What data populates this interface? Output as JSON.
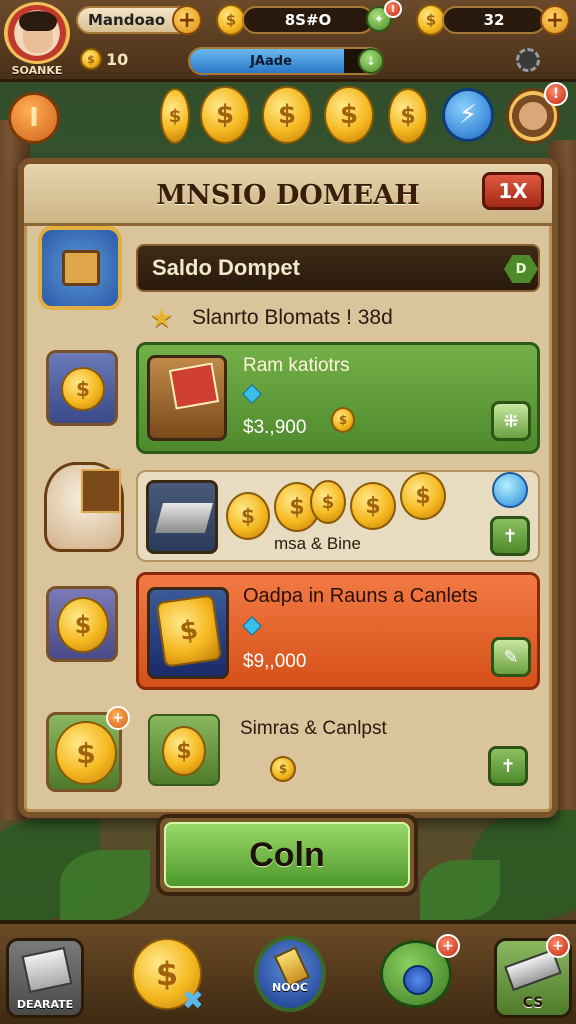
{
  "top_bar": {
    "player_name": "Mandoao",
    "avatar_label": "SOANKE",
    "currency_1": "8S#O",
    "currency_2": "32",
    "small_coin_count": "10",
    "progress_label": "JAade",
    "progress_fraction": 0.8
  },
  "panel": {
    "title": "MNSIO DOMEAH",
    "close_label": "1X",
    "wallet_label": "Saldo Dompet",
    "wallet_badge": "D",
    "subtitle": "Slanrto Blomats ! 38d",
    "rows": [
      {
        "title": "Ram katiotrs",
        "price": "$3.,900"
      },
      {
        "title": "msa & Bine"
      },
      {
        "title": "Oadpa in Rauns a Canlets",
        "price": "$9,,000"
      },
      {
        "title": "Simras & Canlpst"
      }
    ]
  },
  "primary_button": {
    "label": "Coln"
  },
  "bottom_nav": [
    {
      "label": "DEARATE"
    },
    {
      "label": ""
    },
    {
      "label": "NOOC"
    },
    {
      "label": ""
    },
    {
      "label": "CS"
    }
  ],
  "colors": {
    "accent_green": "#4e8a2c",
    "accent_orange": "#d65018",
    "panel_bg": "#d9c49b",
    "frame_brown": "#7a5228"
  },
  "icons": [
    "shield-icon",
    "star-icon",
    "coin-icon",
    "gem-icon",
    "chest-icon",
    "plus-icon",
    "lightning-icon",
    "close-icon"
  ]
}
